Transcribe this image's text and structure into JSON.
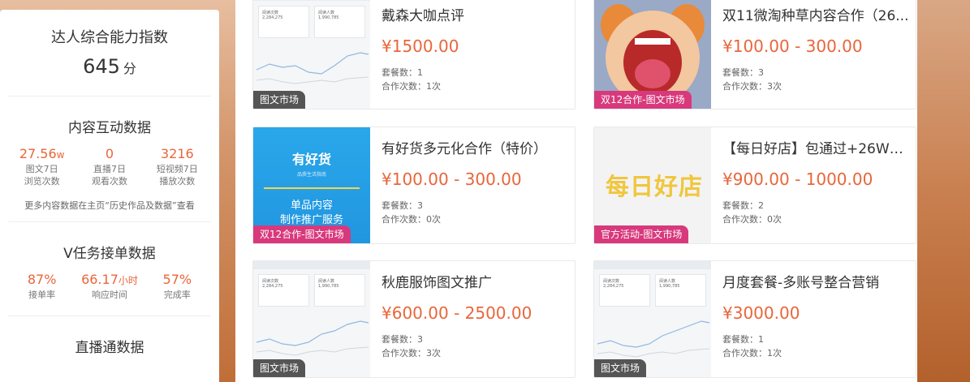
{
  "sidebar": {
    "score": {
      "title": "达人综合能力指数",
      "value": "645",
      "unit": "分"
    },
    "content_interaction": {
      "title": "内容互动数据",
      "stats": [
        {
          "value": "27.56",
          "unit": "w",
          "label1": "图文7日",
          "label2": "浏览次数"
        },
        {
          "value": "0",
          "unit": "",
          "label1": "直播7日",
          "label2": "观看次数"
        },
        {
          "value": "3216",
          "unit": "",
          "label1": "短视频7日",
          "label2": "播放次数"
        }
      ],
      "note": "更多内容数据在主页“历史作品及数据”查看"
    },
    "v_task": {
      "title": "V任务接单数据",
      "stats": [
        {
          "value": "87%",
          "unit": "",
          "label": "接单率"
        },
        {
          "value": "66.17",
          "unit": "小时",
          "label": "响应时间"
        },
        {
          "value": "57%",
          "unit": "",
          "label": "完成率"
        }
      ]
    },
    "live": {
      "title": "直播通数据"
    }
  },
  "cards": [
    {
      "title": "戴森大咖点评",
      "price": "¥1500.00",
      "package_label": "套餐数：",
      "package_count": "1",
      "coop_label": "合作次数：",
      "coop_count": "1次",
      "tag": "图文市场"
    },
    {
      "title": "双11微淘种草内容合作（26...",
      "price": "¥100.00 - 300.00",
      "package_label": "套餐数：",
      "package_count": "3",
      "coop_label": "合作次数：",
      "coop_count": "3次",
      "tag": "双12合作-图文市场"
    },
    {
      "title": "有好货多元化合作（特价）",
      "price": "¥100.00 - 300.00",
      "package_label": "套餐数：",
      "package_count": "3",
      "coop_label": "合作次数：",
      "coop_count": "0次",
      "tag": "双12合作-图文市场"
    },
    {
      "title": "【每日好店】包通过+26W粉...",
      "price": "¥900.00 - 1000.00",
      "package_label": "套餐数：",
      "package_count": "2",
      "coop_label": "合作次数：",
      "coop_count": "0次",
      "tag": "官方活动-图文市场"
    },
    {
      "title": "秋鹿服饰图文推广",
      "price": "¥600.00 - 2500.00",
      "package_label": "套餐数：",
      "package_count": "3",
      "coop_label": "合作次数：",
      "coop_count": "3次",
      "tag": "图文市场"
    },
    {
      "title": "月度套餐-多账号整合营销",
      "price": "¥3000.00",
      "package_label": "套餐数：",
      "package_count": "1",
      "coop_label": "合作次数：",
      "coop_count": "1次",
      "tag": "图文市场"
    }
  ],
  "thumbs": {
    "stats_box1_title": "阅读次数",
    "stats_box1_value": "2,284,275",
    "stats_box2_title": "阅读人数",
    "stats_box2_value": "1,990,785",
    "yhh_logo": "有好货",
    "yhh_sub": "品质生活指南",
    "yhh_big1": "单品内容",
    "yhh_big2": "制作推广服务",
    "mrhd_logo": "每日好店"
  },
  "colors": {
    "accent": "#e8663b",
    "tag_gray": "#555555",
    "tag_pink": "#d8397c"
  }
}
